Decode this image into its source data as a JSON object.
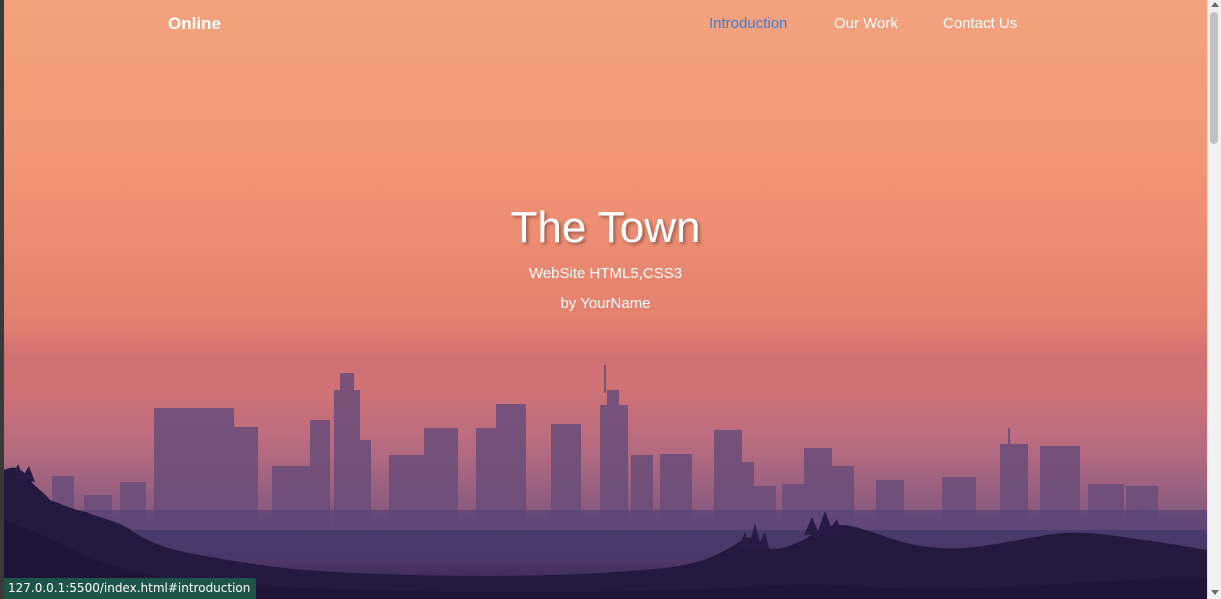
{
  "nav": {
    "brand": "Online",
    "links": [
      {
        "label": "Introduction",
        "active": true
      },
      {
        "label": "Our Work",
        "active": false
      },
      {
        "label": "Contact Us",
        "active": false
      }
    ]
  },
  "hero": {
    "title": "The Town",
    "subtitle": "WebSite HTML5,CSS3",
    "byline": "by YourName"
  },
  "status_bar": {
    "url": "127.0.0.1:5500/index.html#introduction"
  },
  "colors": {
    "active_link": "#3d7fd6",
    "status_bg": "#1f5448"
  }
}
